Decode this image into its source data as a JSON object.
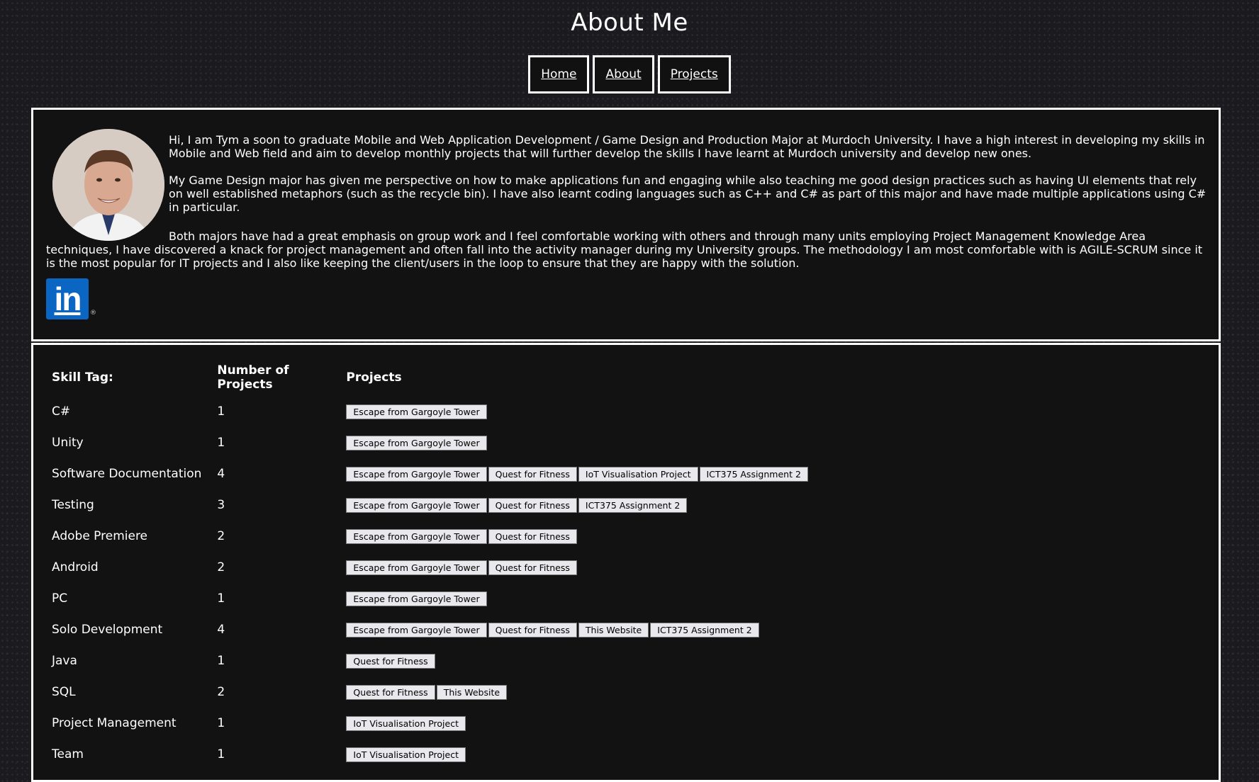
{
  "page": {
    "title": "About Me"
  },
  "nav": [
    {
      "label": "Home"
    },
    {
      "label": "About"
    },
    {
      "label": "Projects"
    }
  ],
  "about": {
    "p1": "Hi, I am Tym a soon to graduate Mobile and Web Application Development / Game Design and Production Major at Murdoch University. I have a high interest in developing my skills in Mobile and Web field and aim to develop monthly projects that will further develop the skills I have learnt at Murdoch university and develop new ones.",
    "p2": "My Game Design major has given me perspective on how to make applications fun and engaging while also teaching me good design practices such as having UI elements that rely on well established metaphors (such as the recycle bin). I have also learnt coding languages such as C++ and C# as part of this major and have made multiple applications using C# in particular.",
    "p3": "Both majors have had a great emphasis on group work and I feel comfortable working with others and through many units employing Project Management Knowledge Area techniques, I have discovered a knack for project management and often fall into the activity manager during my University groups. The methodology I am most comfortable with is AGILE-SCRUM since it is the most popular for IT projects and I also like keeping the client/users in the loop to ensure that they are happy with the solution.",
    "linkedin_text": "in",
    "linkedin_reg": "®"
  },
  "skills": {
    "headers": [
      "Skill Tag:",
      "Number of Projects",
      "Projects"
    ],
    "rows": [
      {
        "tag": "C#",
        "count": "1",
        "projects": [
          "Escape from Gargoyle Tower"
        ]
      },
      {
        "tag": "Unity",
        "count": "1",
        "projects": [
          "Escape from Gargoyle Tower"
        ]
      },
      {
        "tag": "Software Documentation",
        "count": "4",
        "projects": [
          "Escape from Gargoyle Tower",
          "Quest for Fitness",
          "IoT Visualisation Project",
          "ICT375 Assignment 2"
        ]
      },
      {
        "tag": "Testing",
        "count": "3",
        "projects": [
          "Escape from Gargoyle Tower",
          "Quest for Fitness",
          "ICT375 Assignment 2"
        ]
      },
      {
        "tag": "Adobe Premiere",
        "count": "2",
        "projects": [
          "Escape from Gargoyle Tower",
          "Quest for Fitness"
        ]
      },
      {
        "tag": "Android",
        "count": "2",
        "projects": [
          "Escape from Gargoyle Tower",
          "Quest for Fitness"
        ]
      },
      {
        "tag": "PC",
        "count": "1",
        "projects": [
          "Escape from Gargoyle Tower"
        ]
      },
      {
        "tag": "Solo Development",
        "count": "4",
        "projects": [
          "Escape from Gargoyle Tower",
          "Quest for Fitness",
          "This Website",
          "ICT375 Assignment 2"
        ]
      },
      {
        "tag": "Java",
        "count": "1",
        "projects": [
          "Quest for Fitness"
        ]
      },
      {
        "tag": "SQL",
        "count": "2",
        "projects": [
          "Quest for Fitness",
          "This Website"
        ]
      },
      {
        "tag": "Project Management",
        "count": "1",
        "projects": [
          "IoT Visualisation Project"
        ]
      },
      {
        "tag": "Team",
        "count": "1",
        "projects": [
          "IoT Visualisation Project"
        ]
      }
    ]
  }
}
